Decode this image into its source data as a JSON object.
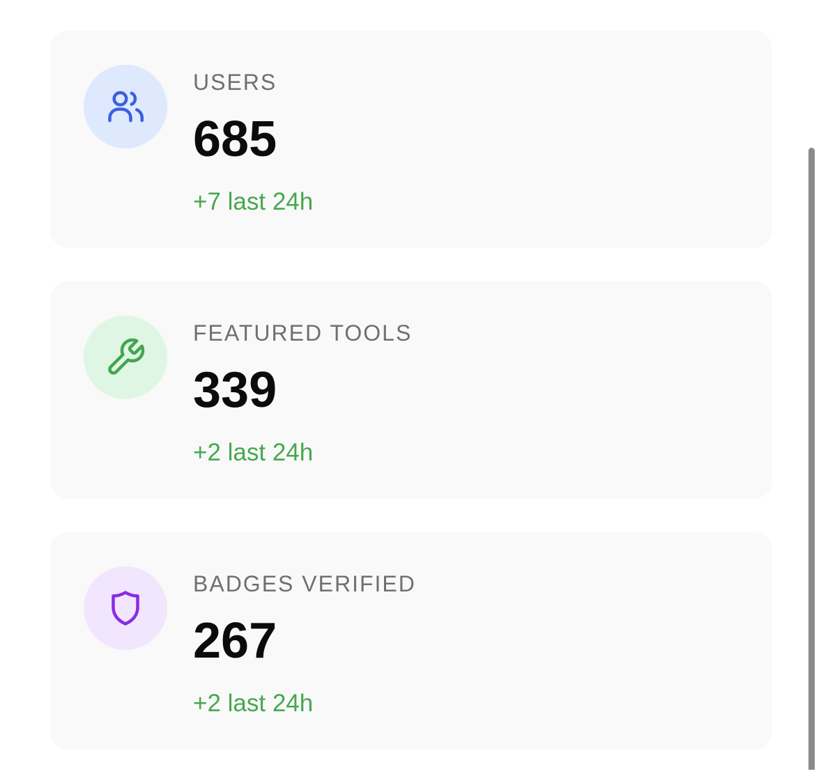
{
  "stats": [
    {
      "label": "USERS",
      "value": "685",
      "delta": "+7 last 24h",
      "icon": "users-icon",
      "icon_color": "#3b5fe0",
      "icon_bg": "#dfe9fd"
    },
    {
      "label": "FEATURED TOOLS",
      "value": "339",
      "delta": "+2 last 24h",
      "icon": "wrench-icon",
      "icon_color": "#44a550",
      "icon_bg": "#e0f6e4"
    },
    {
      "label": "BADGES VERIFIED",
      "value": "267",
      "delta": "+2 last 24h",
      "icon": "shield-icon",
      "icon_color": "#8a2be8",
      "icon_bg": "#f1e6fd"
    }
  ],
  "colors": {
    "card_bg": "#f9f9f9",
    "label": "#6f6f6f",
    "value": "#0b0b0b",
    "delta": "#46a84e"
  }
}
